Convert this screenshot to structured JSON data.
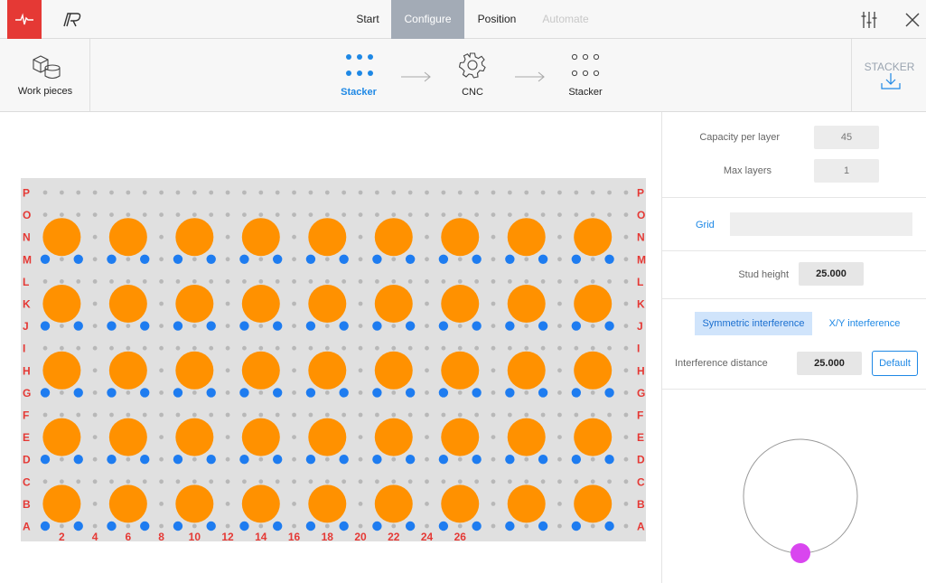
{
  "nav": {
    "tabs": [
      {
        "label": "Start",
        "state": "normal"
      },
      {
        "label": "Configure",
        "state": "active"
      },
      {
        "label": "Position",
        "state": "normal"
      },
      {
        "label": "Automate",
        "state": "disabled"
      }
    ]
  },
  "workflow": {
    "workpieces_label": "Work pieces",
    "steps": [
      {
        "label": "Stacker",
        "icon": "dots-grid-icon",
        "active": true
      },
      {
        "label": "CNC",
        "icon": "gear-icon",
        "active": false
      },
      {
        "label": "Stacker",
        "icon": "dots-grid-outline-icon",
        "active": false
      }
    ],
    "right_label": "STACKER",
    "right_icon": "download-icon"
  },
  "grid": {
    "rows": [
      "A",
      "B",
      "C",
      "D",
      "E",
      "F",
      "G",
      "H",
      "I",
      "J",
      "K",
      "L",
      "M",
      "N",
      "O",
      "P"
    ],
    "col_labels": [
      "2",
      "4",
      "6",
      "8",
      "10",
      "12",
      "14",
      "16",
      "18",
      "20",
      "22",
      "24",
      "26"
    ],
    "piece_columns": [
      2,
      6,
      10,
      14,
      18,
      22,
      26,
      30,
      34
    ],
    "piece_rows": [
      "B",
      "E",
      "H",
      "K",
      "N"
    ],
    "colors": {
      "piece": "#ff9100",
      "stud": "#1e7cf0",
      "peg": "#b8b8b8",
      "label": "#e53935",
      "board": "#e0e0e0"
    }
  },
  "settings": {
    "capacity_label": "Capacity per layer",
    "capacity_value": "45",
    "max_layers_label": "Max layers",
    "max_layers_value": "1",
    "grid_label": "Grid",
    "grid_value": "",
    "stud_height_label": "Stud height",
    "stud_height_value": "25.000",
    "symmetric_label": "Symmetric interference",
    "xy_label": "X/Y interference",
    "interference_label": "Interference distance",
    "interference_value": "25.000",
    "default_label": "Default"
  },
  "dial": {
    "handle_color": "#d946ef"
  }
}
